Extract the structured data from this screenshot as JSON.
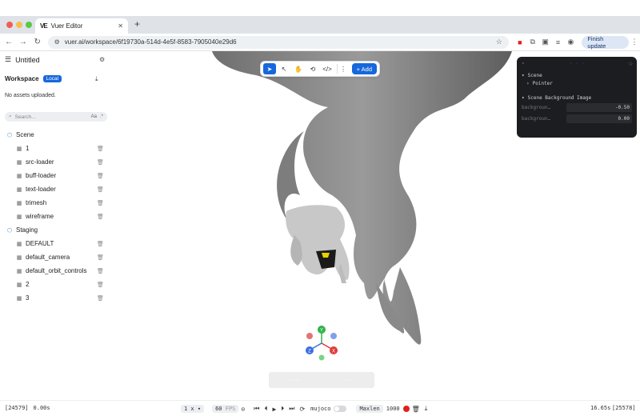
{
  "browser": {
    "tab_title": "Vuer Editor",
    "tab_favicon": "VE",
    "url": "vuer.ai/workspace/6f19730a-514d-4e5f-8583-7905040e29d6",
    "finish_update_label": "Finish update"
  },
  "sidebar": {
    "title": "Untitled",
    "workspace_label": "Workspace",
    "workspace_badge": "Local",
    "no_assets": "No assets uploaded.",
    "search_placeholder": "Search...",
    "search_match_case": "Aa",
    "search_regex": ".*",
    "groups": [
      {
        "label": "Scene",
        "items": [
          "1",
          "src-loader",
          "buff-loader",
          "text-loader",
          "trimesh",
          "wireframe"
        ]
      },
      {
        "label": "Staging",
        "items": [
          "DEFAULT",
          "default_camera",
          "default_orbit_controls",
          "2",
          "3"
        ]
      }
    ]
  },
  "toolbar": {
    "add_label": "+ Add"
  },
  "inspector": {
    "section_scene": "Scene",
    "pointer": "Pointer",
    "section_bg": "Scene Background Image",
    "fields": [
      {
        "label": "backgroun…",
        "value": "-0.50"
      },
      {
        "label": "backgroun…",
        "value": "0.00"
      }
    ]
  },
  "gizmo": {
    "y": "Y",
    "x": "X",
    "z": "Z"
  },
  "bottom_bar": {
    "frame_left": "[24579]",
    "time_left": "0.00s",
    "speed": "1 x",
    "fps_value": "60",
    "fps_label": "FPS",
    "mujoco": "mujoco",
    "maxlen_label": "Maxlen",
    "maxlen_value": "1000",
    "time_right": "16.65s",
    "frame_right": "[25578]"
  },
  "colors": {
    "accent": "#1668dc",
    "gizmo_x": "#e03a3a",
    "gizmo_y": "#2fb34a",
    "gizmo_z": "#3a6fe0",
    "record": "#e02020"
  }
}
